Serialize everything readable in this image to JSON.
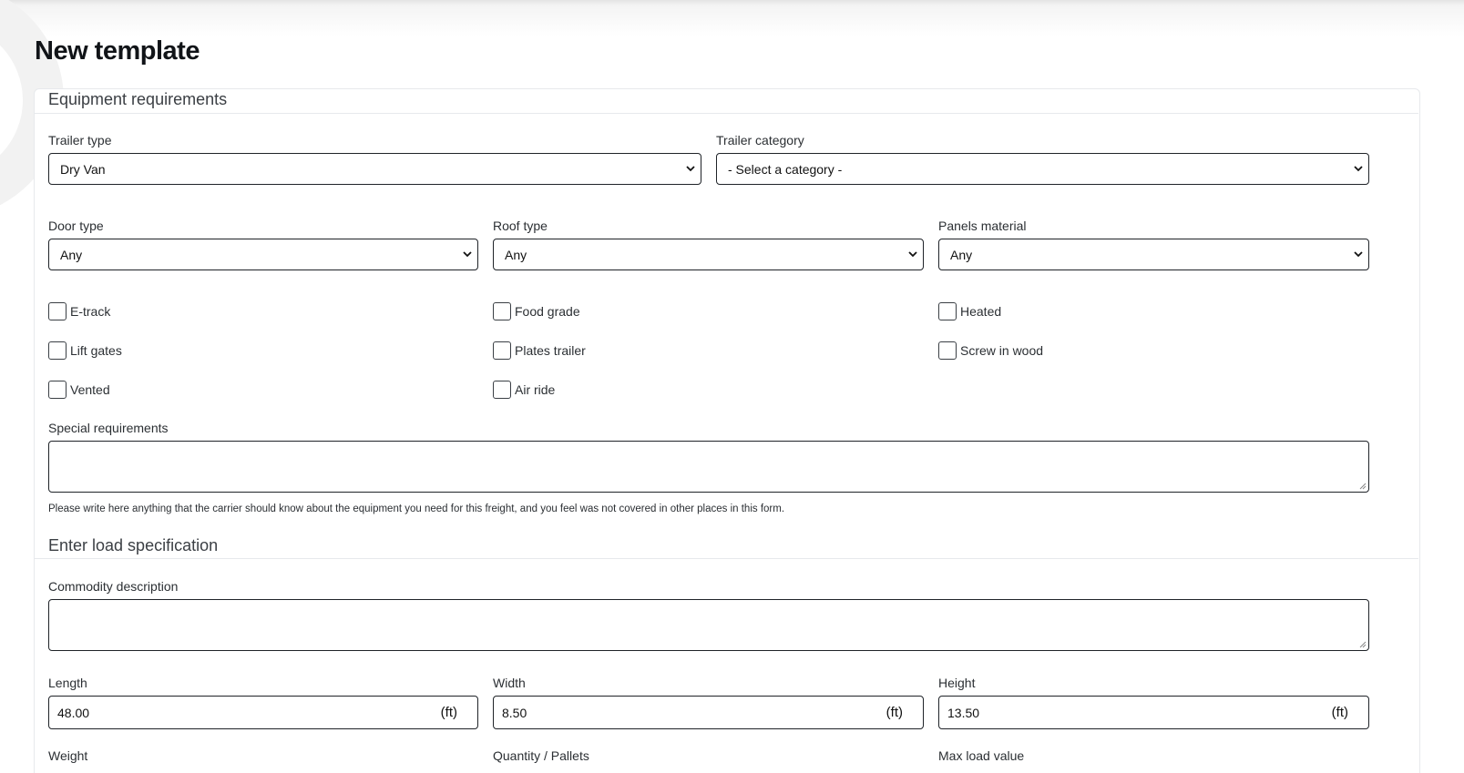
{
  "page": {
    "title": "New template"
  },
  "equipment": {
    "section_title": "Equipment requirements",
    "trailer_type": {
      "label": "Trailer type",
      "value": "Dry Van"
    },
    "trailer_category": {
      "label": "Trailer category",
      "value": "- Select a category -"
    },
    "door_type": {
      "label": "Door type",
      "value": "Any"
    },
    "roof_type": {
      "label": "Roof type",
      "value": "Any"
    },
    "panels_material": {
      "label": "Panels material",
      "value": "Any"
    },
    "options": [
      {
        "label": "E-track",
        "checked": false
      },
      {
        "label": "Food grade",
        "checked": false
      },
      {
        "label": "Heated",
        "checked": false
      },
      {
        "label": "Lift gates",
        "checked": false
      },
      {
        "label": "Plates trailer",
        "checked": false
      },
      {
        "label": "Screw in wood",
        "checked": false
      },
      {
        "label": "Vented",
        "checked": false
      },
      {
        "label": "Air ride",
        "checked": false
      }
    ],
    "special_requirements": {
      "label": "Special requirements",
      "value": "",
      "help": "Please write here anything that the carrier should know about the equipment you need for this freight, and you feel was not covered in other places in this form."
    }
  },
  "load": {
    "section_title": "Enter load specification",
    "commodity": {
      "label": "Commodity description",
      "value": ""
    },
    "length": {
      "label": "Length",
      "value": "48.00",
      "unit": "(ft)"
    },
    "width": {
      "label": "Width",
      "value": "8.50",
      "unit": "(ft)"
    },
    "height": {
      "label": "Height",
      "value": "13.50",
      "unit": "(ft)"
    },
    "weight": {
      "label": "Weight"
    },
    "quantity": {
      "label": "Quantity / Pallets"
    },
    "max_load_value": {
      "label": "Max load value"
    }
  },
  "icons": {
    "select_arrow": "chevron-down-icon",
    "checkbox": "checkbox-icon",
    "resize": "resize-grip-icon"
  }
}
